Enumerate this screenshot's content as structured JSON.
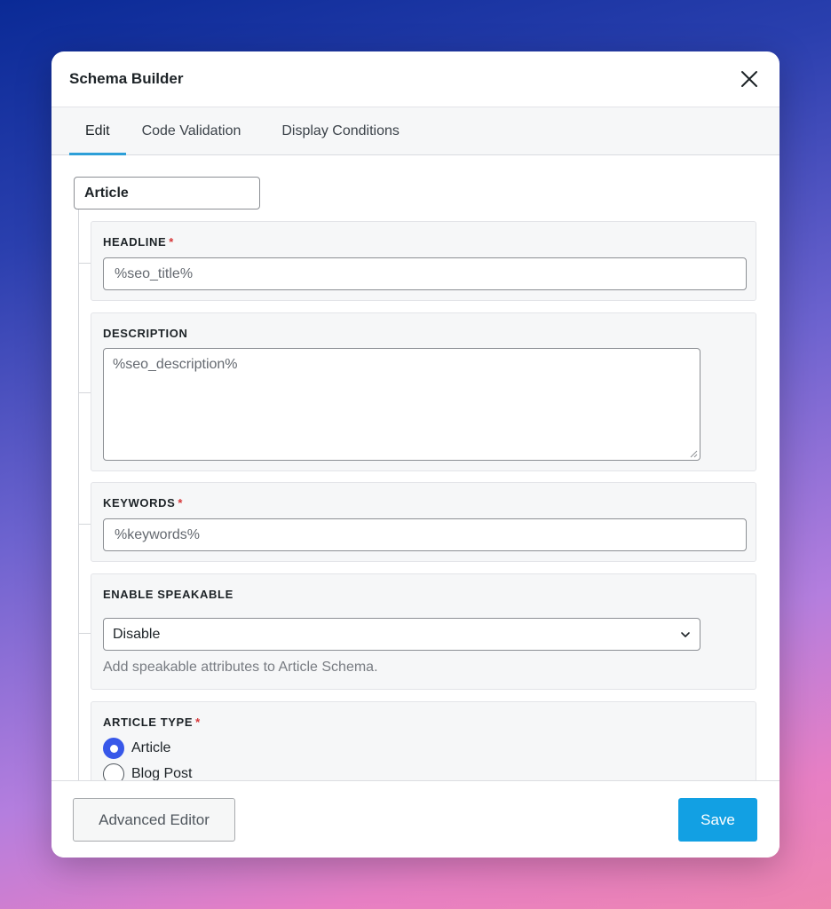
{
  "modal": {
    "title": "Schema Builder",
    "close_icon": "close-icon"
  },
  "tabs": [
    {
      "label": "Edit",
      "active": true
    },
    {
      "label": "Code Validation",
      "active": false
    },
    {
      "label": "Display Conditions",
      "active": false
    }
  ],
  "schema_type": "Article",
  "fields": {
    "headline": {
      "label": "HEADLINE",
      "required": "*",
      "value": "%seo_title%"
    },
    "description": {
      "label": "DESCRIPTION",
      "value": "%seo_description%"
    },
    "keywords": {
      "label": "KEYWORDS",
      "required": "*",
      "value": "%keywords%"
    },
    "speakable": {
      "label": "ENABLE SPEAKABLE",
      "selected": "Disable",
      "help": "Add speakable attributes to Article Schema."
    },
    "article_type": {
      "label": "ARTICLE TYPE",
      "required": "*",
      "options": [
        {
          "label": "Article",
          "checked": true
        },
        {
          "label": "Blog Post",
          "checked": false
        }
      ]
    }
  },
  "footer": {
    "advanced_editor_label": "Advanced Editor",
    "save_label": "Save"
  },
  "colors": {
    "accent": "#12a0e3",
    "tab_indicator": "#2d9fd8",
    "radio_checked": "#3858e9",
    "required": "#d63638"
  }
}
